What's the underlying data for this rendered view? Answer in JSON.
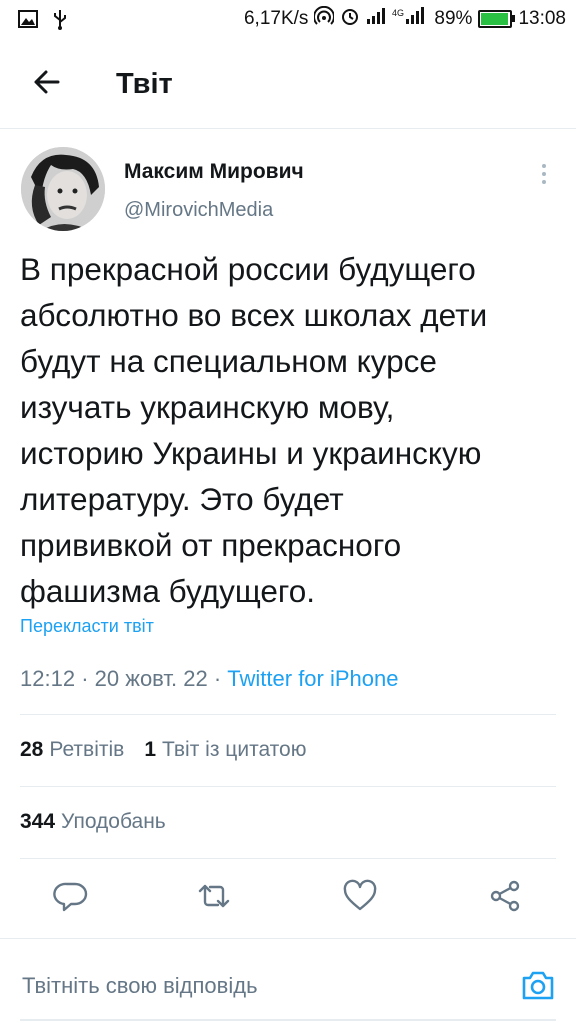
{
  "status_bar": {
    "speed": "6,17K/s",
    "battery_percent": "89%",
    "battery_level": 0.89,
    "time": "13:08",
    "network": "4G",
    "left_icons": [
      "image-icon",
      "usb-icon"
    ],
    "right_icons": [
      "hotspot-icon",
      "alarm-icon",
      "signal-icon",
      "signal-4g-icon",
      "battery-icon"
    ]
  },
  "header": {
    "title": "Твіт",
    "back_icon": "arrow-left-icon"
  },
  "tweet": {
    "author_name": "Максим Мирович",
    "author_handle": "@MirovichMedia",
    "text": "В прекрасной россии будущего\nабсолютно во всех школах дети\nбудут на специальном курсе\nизучать украинскую мову,\nисторию Украины и украинскую\nлитературу. Это будет\nпрививкой от прекрасного\nфашизма будущего.",
    "translate_label": "Перекласти твіт",
    "time": "12:12",
    "date": "20 жовт. 22",
    "separator": "·",
    "source": "Twitter for iPhone"
  },
  "stats": {
    "retweets_count": "28",
    "retweets_label": "Ретвітів",
    "quotes_count": "1",
    "quotes_label": "Твіт із цитатою",
    "likes_count": "344",
    "likes_label": "Уподобань"
  },
  "actions": [
    "reply-icon",
    "retweet-icon",
    "like-icon",
    "share-icon"
  ],
  "reply": {
    "placeholder": "Твітніть свою відповідь",
    "camera_icon": "camera-icon"
  },
  "colors": {
    "accent": "#1da1f2",
    "secondary_text": "#657786",
    "divider": "#e6ecf0",
    "battery": "#29c043"
  }
}
